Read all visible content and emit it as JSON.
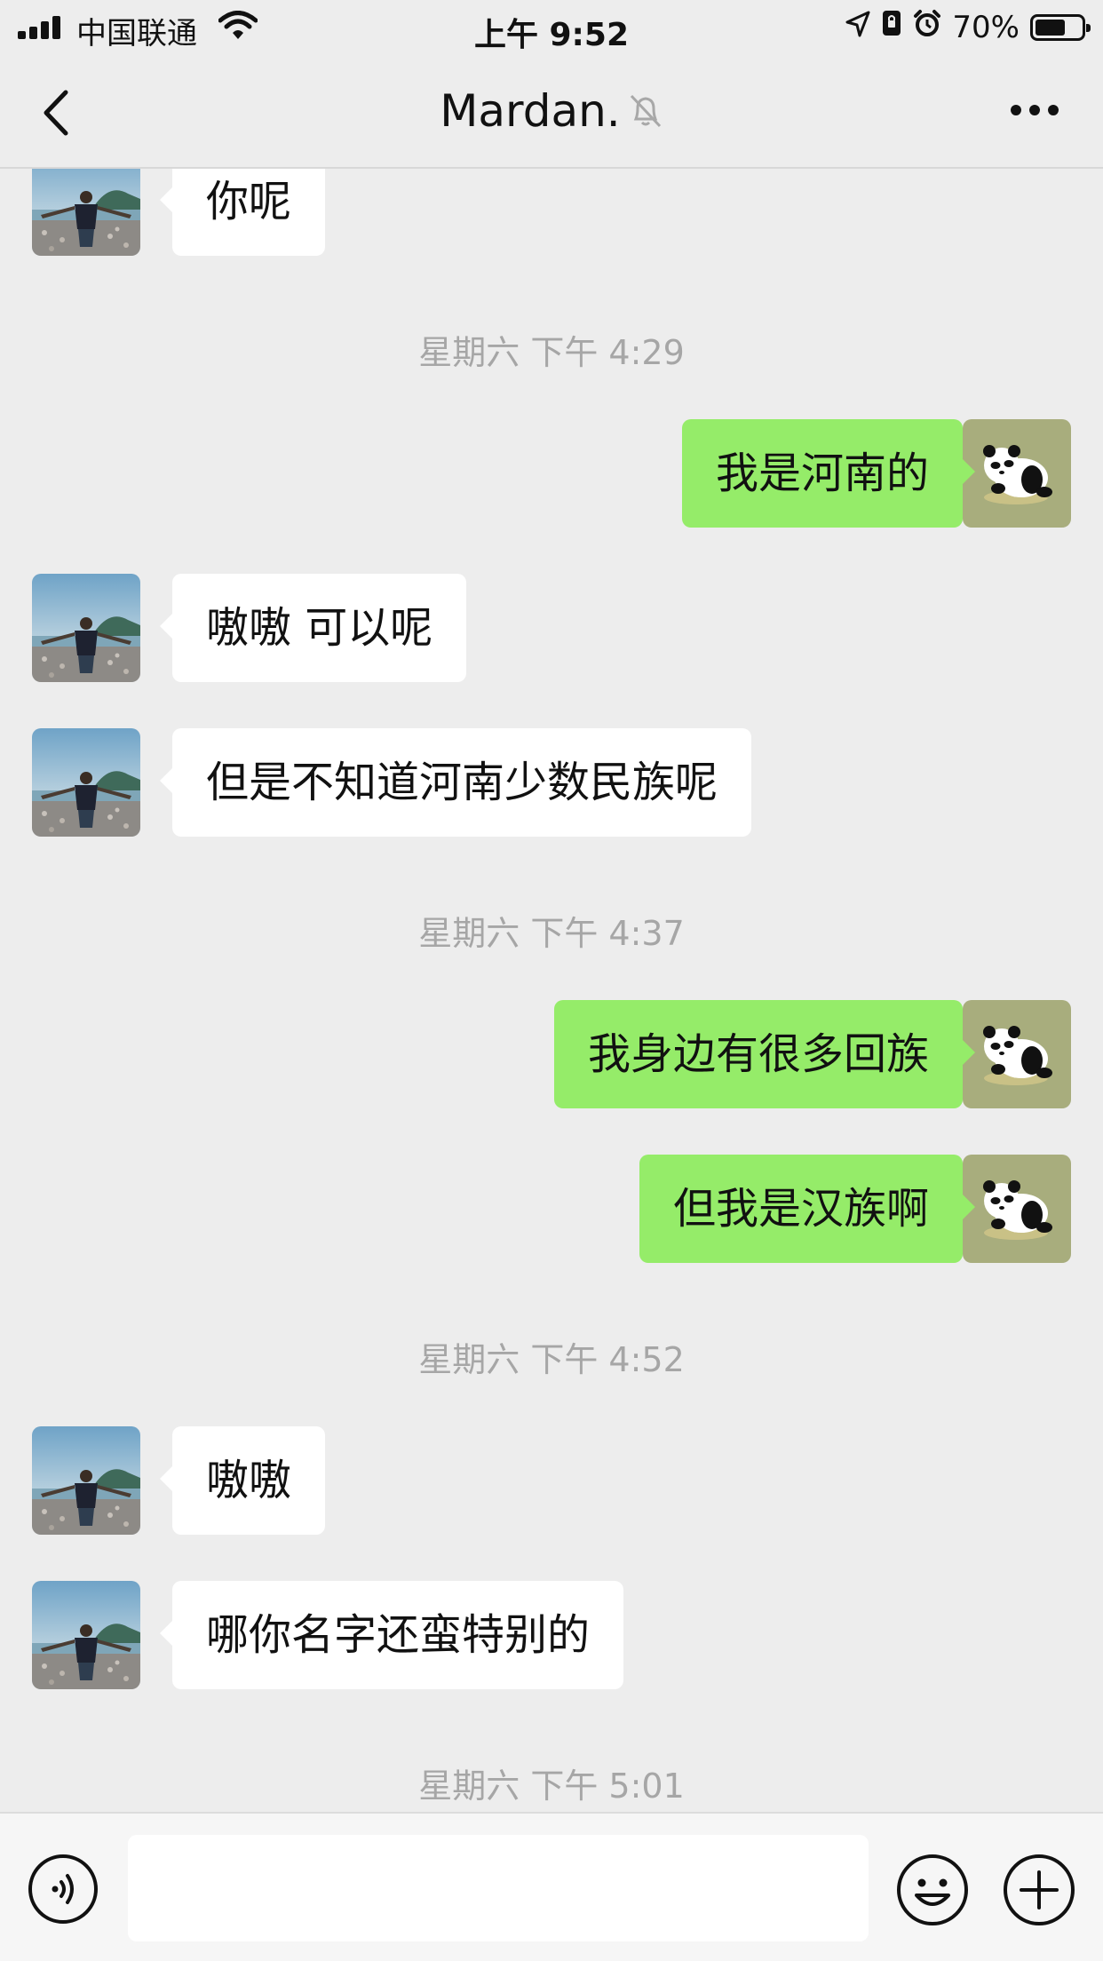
{
  "status_bar": {
    "carrier": "中国联通",
    "time": "上午 9:52",
    "battery": "70%",
    "battery_level": 0.7
  },
  "nav": {
    "title": "Mardan.",
    "muted": true
  },
  "colors": {
    "background": "#ededed",
    "incoming_bubble": "#ffffff",
    "outgoing_bubble": "#95ec69",
    "timestamp_text": "#a6a6a6"
  },
  "chat": {
    "messages": [
      {
        "side": "left",
        "text": "你呢"
      },
      {
        "timestamp": "星期六 下午 4:29"
      },
      {
        "side": "right",
        "text": "我是河南的"
      },
      {
        "side": "left",
        "text": "嗷嗷 可以呢"
      },
      {
        "side": "left",
        "text": "但是不知道河南少数民族呢"
      },
      {
        "timestamp": "星期六 下午 4:37"
      },
      {
        "side": "right",
        "text": "我身边有很多回族"
      },
      {
        "side": "right",
        "text": "但我是汉族啊"
      },
      {
        "timestamp": "星期六 下午 4:52"
      },
      {
        "side": "left",
        "text": "嗷嗷"
      },
      {
        "side": "left",
        "text": "哪你名字还蛮特别的"
      },
      {
        "timestamp": "星期六 下午 5:01"
      }
    ]
  },
  "input": {
    "value": "",
    "icons": [
      "voice-icon",
      "emoji-icon",
      "plus-icon"
    ]
  }
}
